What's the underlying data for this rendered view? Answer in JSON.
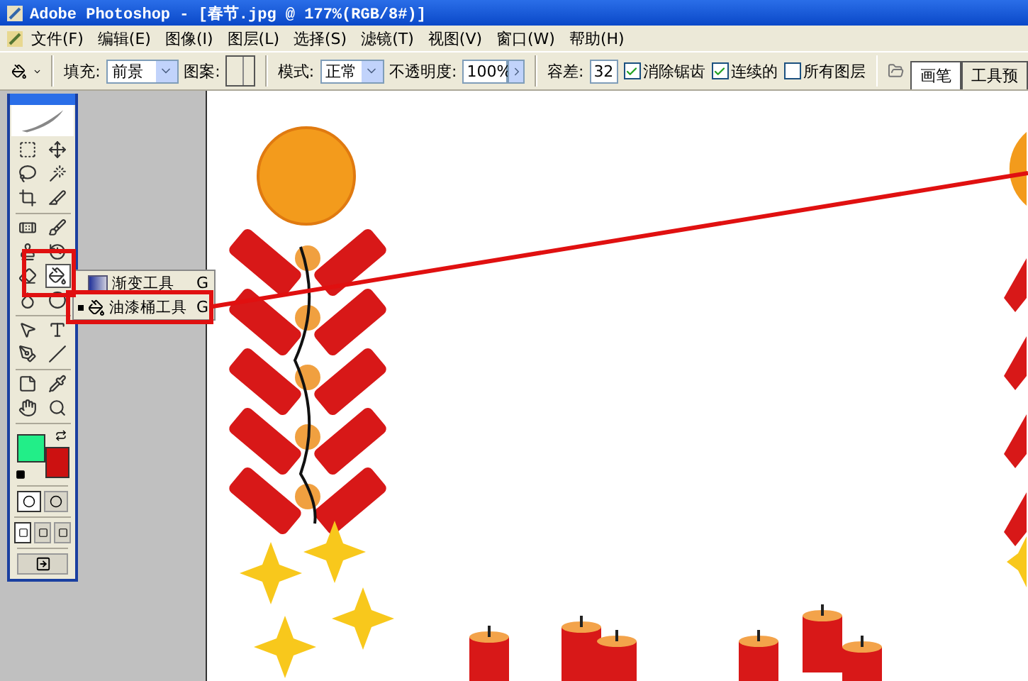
{
  "window": {
    "title": "Adobe Photoshop - [春节.jpg @ 177%(RGB/8#)]"
  },
  "menu": [
    "文件(F)",
    "编辑(E)",
    "图像(I)",
    "图层(L)",
    "选择(S)",
    "滤镜(T)",
    "视图(V)",
    "窗口(W)",
    "帮助(H)"
  ],
  "options_bar": {
    "fill_label": "填充:",
    "fill_value": "前景",
    "pattern_label": "图案:",
    "mode_label": "模式:",
    "mode_value": "正常",
    "opacity_label": "不透明度:",
    "opacity_value": "100%",
    "tolerance_label": "容差:",
    "tolerance_value": "32",
    "checkboxes": [
      {
        "label": "消除锯齿",
        "checked": true
      },
      {
        "label": "连续的",
        "checked": true
      },
      {
        "label": "所有图层",
        "checked": false
      }
    ],
    "tabs": [
      {
        "label": "画笔",
        "selected": true
      },
      {
        "label": "工具预",
        "selected": false
      }
    ]
  },
  "toolbox": {
    "tool_groups": [
      {
        "tools": [
          {
            "kind": "marquee",
            "selected": false
          },
          {
            "kind": "move",
            "selected": false
          },
          {
            "kind": "lasso",
            "selected": false
          },
          {
            "kind": "wand",
            "selected": false
          },
          {
            "kind": "crop",
            "selected": false
          },
          {
            "kind": "slice",
            "selected": false
          }
        ]
      },
      {
        "tools": [
          {
            "kind": "heal",
            "selected": false
          },
          {
            "kind": "brush",
            "selected": false
          },
          {
            "kind": "stamp",
            "selected": false
          },
          {
            "kind": "history",
            "selected": false
          },
          {
            "kind": "eraser",
            "selected": false
          },
          {
            "kind": "bucket",
            "selected": true
          },
          {
            "kind": "blur",
            "selected": false
          },
          {
            "kind": "dodge",
            "selected": false
          }
        ]
      },
      {
        "tools": [
          {
            "kind": "select",
            "selected": false
          },
          {
            "kind": "type",
            "selected": false
          },
          {
            "kind": "pen",
            "selected": false
          },
          {
            "kind": "line",
            "selected": false
          }
        ]
      },
      {
        "tools": [
          {
            "kind": "notes",
            "selected": false
          },
          {
            "kind": "eyedropper",
            "selected": false
          },
          {
            "kind": "hand",
            "selected": false
          },
          {
            "kind": "zoom",
            "selected": false
          }
        ]
      }
    ],
    "swatches": [
      {
        "kind": "foreground",
        "color": "#22ee88"
      },
      {
        "kind": "background",
        "color": "#cc1111"
      }
    ],
    "mask_modes": [
      {
        "selected": true
      },
      {
        "selected": false
      }
    ],
    "screen_modes": [
      {
        "selected": true
      },
      {
        "selected": false
      },
      {
        "selected": false
      }
    ]
  },
  "flyout_menu": {
    "items": [
      {
        "kind": "gradient",
        "label": "渐变工具",
        "shortcut": "G",
        "selected": false
      },
      {
        "kind": "bucket",
        "label": "油漆桶工具",
        "shortcut": "G",
        "selected": true
      }
    ]
  }
}
